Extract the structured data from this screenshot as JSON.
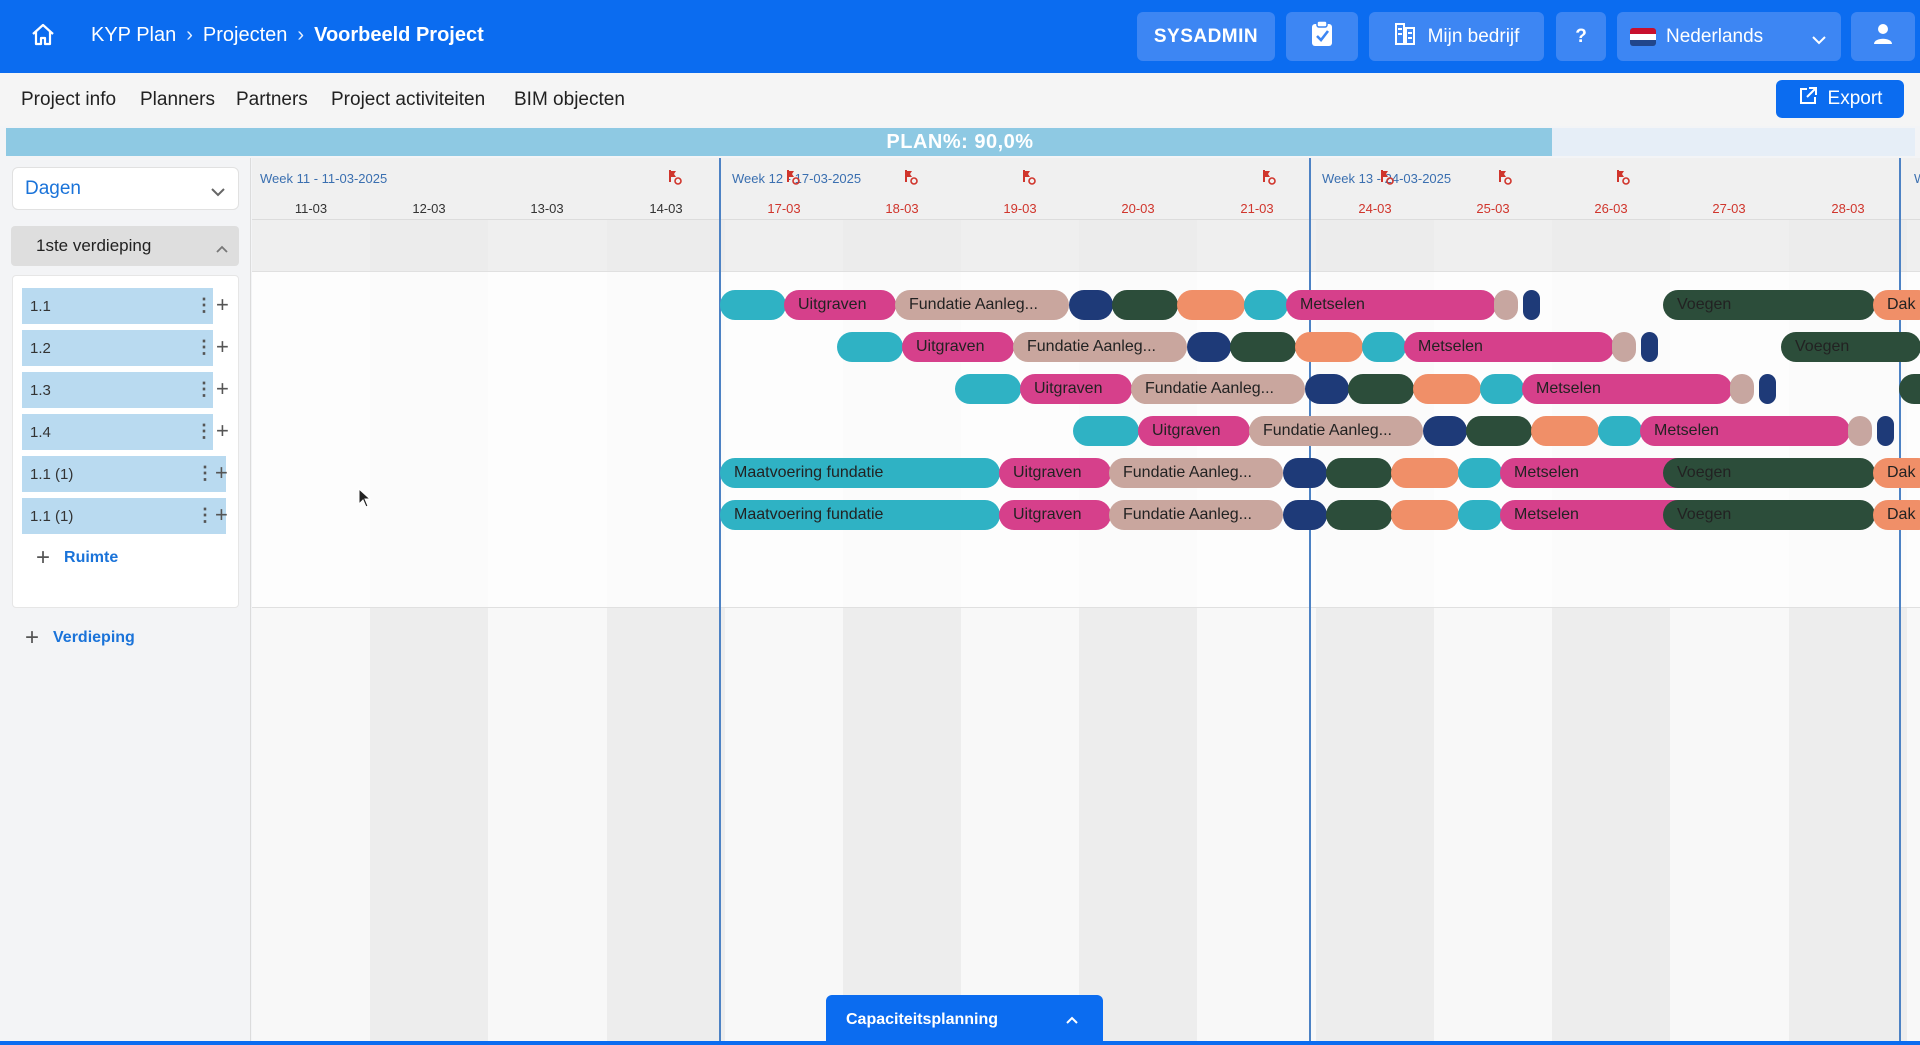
{
  "topbar": {
    "breadcrumb": [
      "KYP Plan",
      "Projecten",
      "Voorbeeld Project"
    ],
    "sysadmin_label": "SYSADMIN",
    "company_label": "Mijn bedrijf",
    "help_label": "?",
    "language_label": "Nederlands",
    "icons": {
      "home": "home-icon",
      "check": "clipboard-check-icon",
      "company": "building-icon",
      "language": "netherlands-flag-icon",
      "user": "user-icon"
    }
  },
  "nav": {
    "items": [
      "Project info",
      "Planners",
      "Partners",
      "Project activiteiten",
      "BIM objecten"
    ],
    "export_label": "Export"
  },
  "plan": {
    "label": "PLAN%: 90,0%",
    "progress": 0.9,
    "color": "#8ec9e3"
  },
  "sidebar": {
    "view_select": "Dagen",
    "floor_name": "1ste verdieping",
    "rooms": [
      "1.1",
      "1.2",
      "1.3",
      "1.4",
      "1.1 (1)",
      "1.1 (1)"
    ],
    "add_room_label": "Ruimte",
    "add_floor_label": "Verdieping"
  },
  "timeline": {
    "weeks": [
      {
        "label": "Week 11 - 11-03-2025"
      },
      {
        "label": "Week 12 - 17-03-2025"
      },
      {
        "label": "Week 13 - 24-03-2025"
      },
      {
        "label": "W"
      }
    ],
    "days": [
      "11-03",
      "12-03",
      "13-03",
      "14-03",
      "17-03",
      "18-03",
      "19-03",
      "20-03",
      "21-03",
      "24-03",
      "25-03",
      "26-03",
      "27-03",
      "28-03"
    ],
    "rows": [
      [
        {
          "c": "teal",
          "t": ""
        },
        {
          "c": "pink",
          "t": "Uitgraven"
        },
        {
          "c": "tan",
          "t": "Fundatie Aanleg..."
        },
        {
          "c": "navy",
          "t": ""
        },
        {
          "c": "dgreen",
          "t": ""
        },
        {
          "c": "orange",
          "t": ""
        },
        {
          "c": "teal",
          "t": ""
        },
        {
          "c": "pink",
          "t": "Metselen"
        },
        {
          "c": "rose",
          "t": ""
        },
        {
          "c": "navy",
          "t": ""
        },
        {
          "c": "dgreen",
          "t": "Voegen"
        },
        {
          "c": "orange",
          "t": "Dak"
        }
      ],
      [
        {
          "c": "teal",
          "t": ""
        },
        {
          "c": "pink",
          "t": "Uitgraven"
        },
        {
          "c": "tan",
          "t": "Fundatie Aanleg..."
        },
        {
          "c": "navy",
          "t": ""
        },
        {
          "c": "dgreen",
          "t": ""
        },
        {
          "c": "orange",
          "t": ""
        },
        {
          "c": "teal",
          "t": ""
        },
        {
          "c": "pink",
          "t": "Metselen"
        },
        {
          "c": "rose",
          "t": ""
        },
        {
          "c": "navy",
          "t": ""
        },
        {
          "c": "dgreen",
          "t": "Voegen"
        }
      ],
      [
        {
          "c": "teal",
          "t": ""
        },
        {
          "c": "pink",
          "t": "Uitgraven"
        },
        {
          "c": "tan",
          "t": "Fundatie Aanleg..."
        },
        {
          "c": "navy",
          "t": ""
        },
        {
          "c": "dgreen",
          "t": ""
        },
        {
          "c": "orange",
          "t": ""
        },
        {
          "c": "teal",
          "t": ""
        },
        {
          "c": "pink",
          "t": "Metselen"
        },
        {
          "c": "rose",
          "t": ""
        },
        {
          "c": "navy",
          "t": ""
        },
        {
          "c": "dgreen",
          "t": ""
        }
      ],
      [
        {
          "c": "teal",
          "t": ""
        },
        {
          "c": "pink",
          "t": "Uitgraven"
        },
        {
          "c": "tan",
          "t": "Fundatie Aanleg..."
        },
        {
          "c": "navy",
          "t": ""
        },
        {
          "c": "dgreen",
          "t": ""
        },
        {
          "c": "orange",
          "t": ""
        },
        {
          "c": "teal",
          "t": ""
        },
        {
          "c": "pink",
          "t": "Metselen"
        },
        {
          "c": "rose",
          "t": ""
        },
        {
          "c": "navy",
          "t": ""
        }
      ],
      [
        {
          "c": "teal",
          "t": "Maatvoering fundatie"
        },
        {
          "c": "pink",
          "t": "Uitgraven"
        },
        {
          "c": "tan",
          "t": "Fundatie Aanleg..."
        },
        {
          "c": "navy",
          "t": ""
        },
        {
          "c": "dgreen",
          "t": ""
        },
        {
          "c": "orange",
          "t": ""
        },
        {
          "c": "teal",
          "t": ""
        },
        {
          "c": "pink",
          "t": "Metselen"
        },
        {
          "c": "dgreen",
          "t": "Voegen"
        },
        {
          "c": "orange",
          "t": "Dak"
        }
      ],
      [
        {
          "c": "teal",
          "t": "Maatvoering fundatie"
        },
        {
          "c": "pink",
          "t": "Uitgraven"
        },
        {
          "c": "tan",
          "t": "Fundatie Aanleg..."
        },
        {
          "c": "navy",
          "t": ""
        },
        {
          "c": "dgreen",
          "t": ""
        },
        {
          "c": "orange",
          "t": ""
        },
        {
          "c": "teal",
          "t": ""
        },
        {
          "c": "pink",
          "t": "Metselen"
        },
        {
          "c": "dgreen",
          "t": "Voegen"
        },
        {
          "c": "orange",
          "t": "Dak"
        }
      ]
    ]
  },
  "bottom": {
    "capacity_label": "Capaciteitsplanning"
  },
  "colors": {
    "brand": "#0b6cf0",
    "teal": "#2fb2c4",
    "pink": "#d6408b",
    "tan": "#c9a69e",
    "navy": "#1e3a78",
    "dark_green": "#2c4d3a",
    "orange": "#f08f68"
  }
}
